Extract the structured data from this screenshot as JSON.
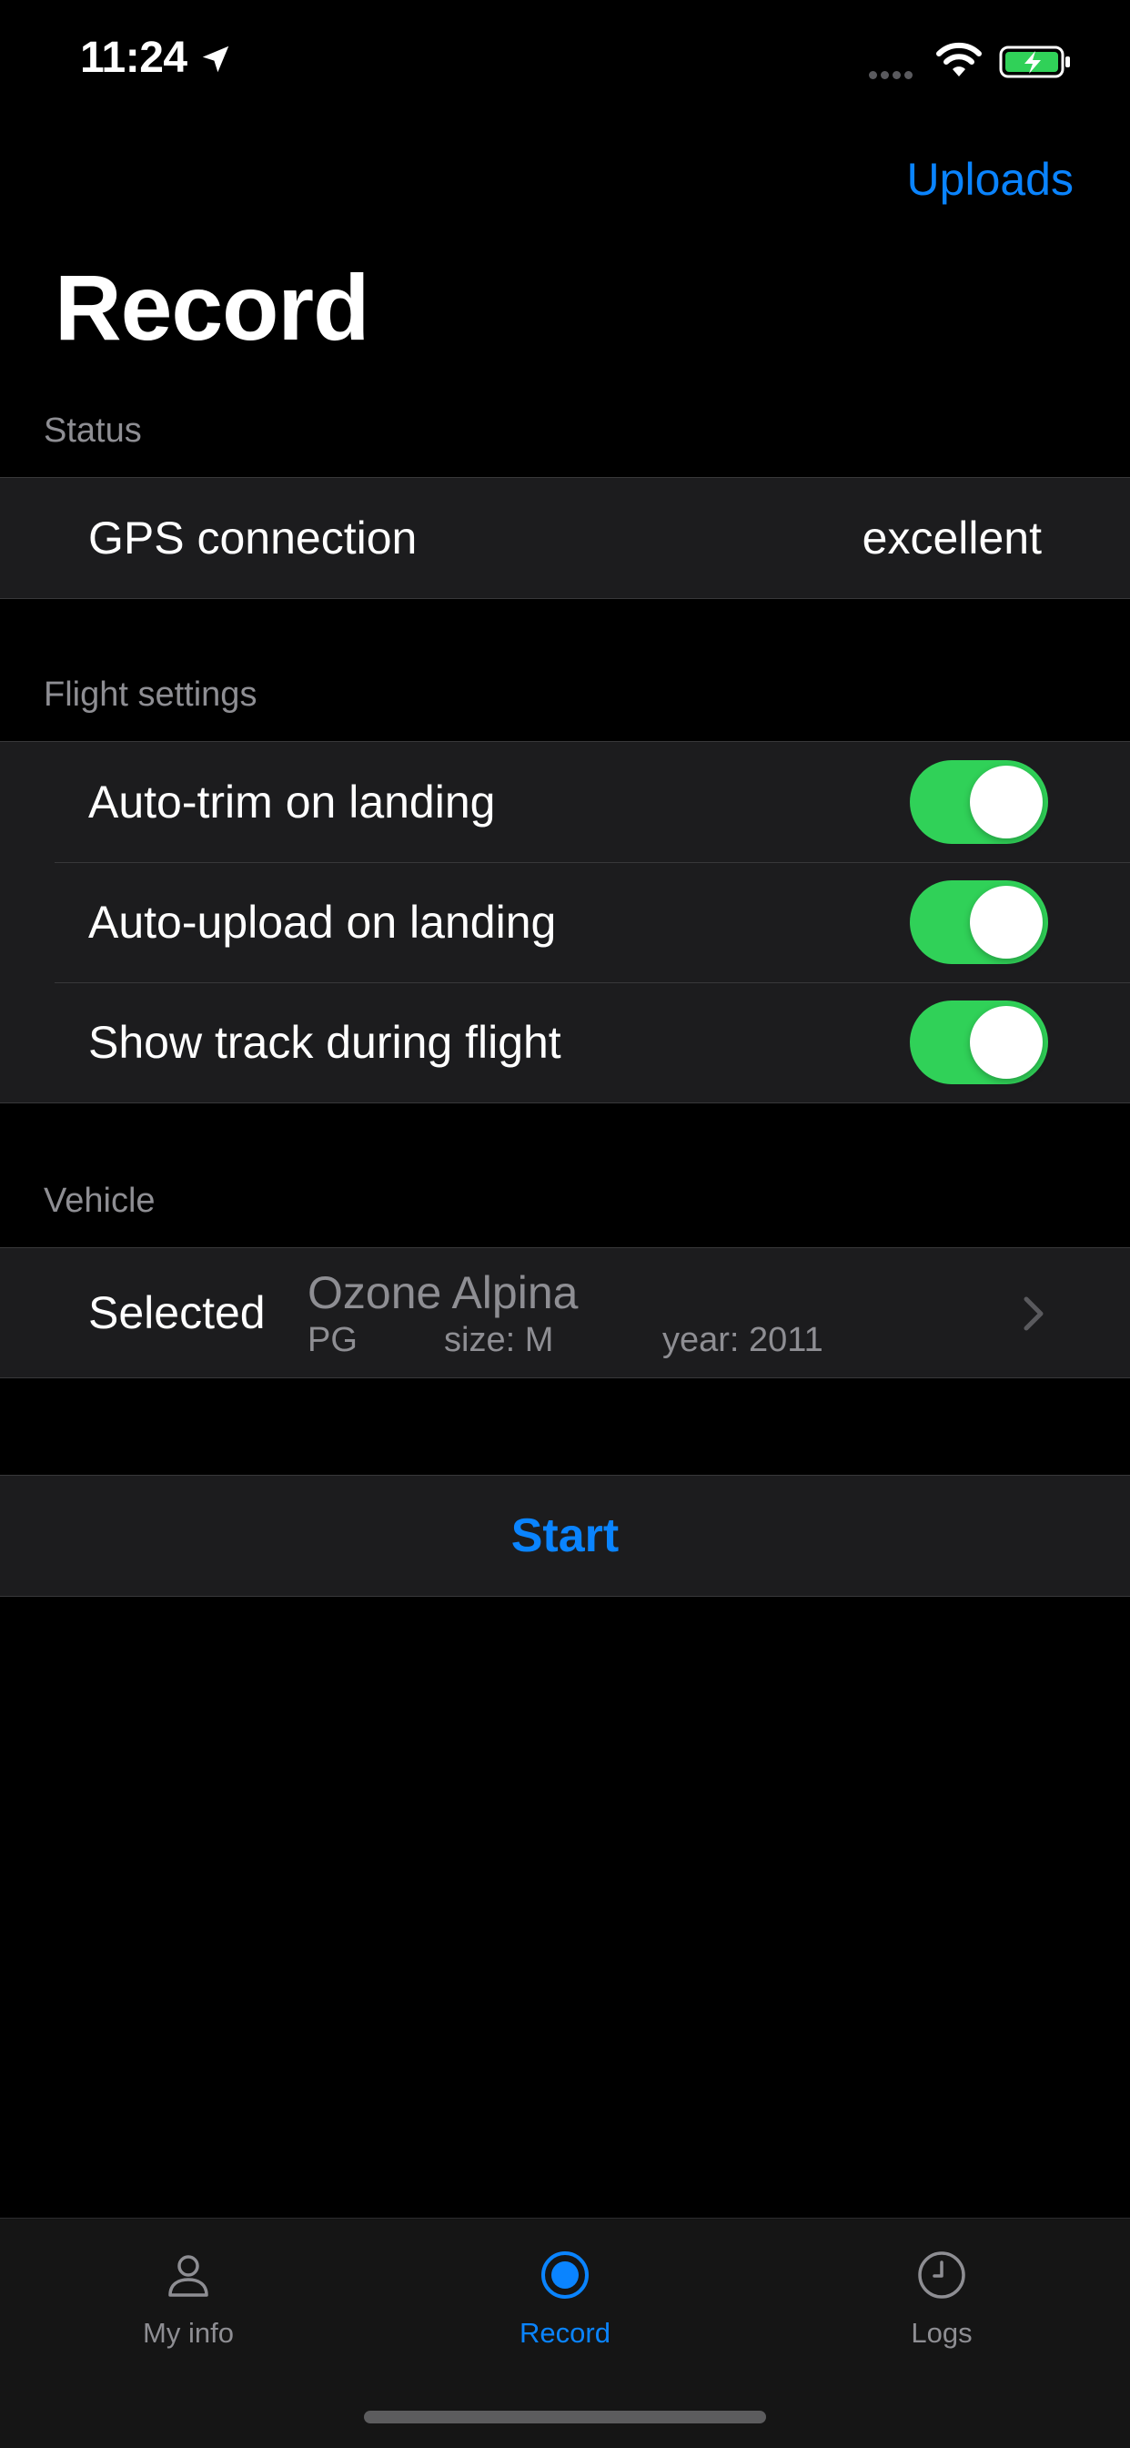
{
  "status_bar": {
    "time": "11:24",
    "location_icon": "location-arrow-icon",
    "signal_icon": "cellular-dots-icon",
    "wifi_icon": "wifi-icon",
    "battery_icon": "battery-charging-icon"
  },
  "nav": {
    "uploads_label": "Uploads",
    "title": "Record"
  },
  "sections": {
    "status": {
      "header": "Status",
      "gps_label": "GPS connection",
      "gps_value": "excellent"
    },
    "flight_settings": {
      "header": "Flight settings",
      "items": [
        {
          "label": "Auto-trim on landing",
          "on": true
        },
        {
          "label": "Auto-upload on landing",
          "on": true
        },
        {
          "label": "Show track during flight",
          "on": true
        }
      ]
    },
    "vehicle": {
      "header": "Vehicle",
      "selected_label": "Selected",
      "name": "Ozone Alpina",
      "type": "PG",
      "size": "size: M",
      "year": "year: 2011"
    }
  },
  "start_label": "Start",
  "tabs": [
    {
      "label": "My info",
      "icon": "person-icon",
      "active": false
    },
    {
      "label": "Record",
      "icon": "record-icon",
      "active": true
    },
    {
      "label": "Logs",
      "icon": "clock-icon",
      "active": false
    }
  ],
  "colors": {
    "accent": "#0a84ff",
    "toggle_on": "#30d158",
    "background": "#000000",
    "cell": "#1c1c1e",
    "secondary_text": "#8e8e93",
    "inactive_tab": "#8e8e93"
  }
}
